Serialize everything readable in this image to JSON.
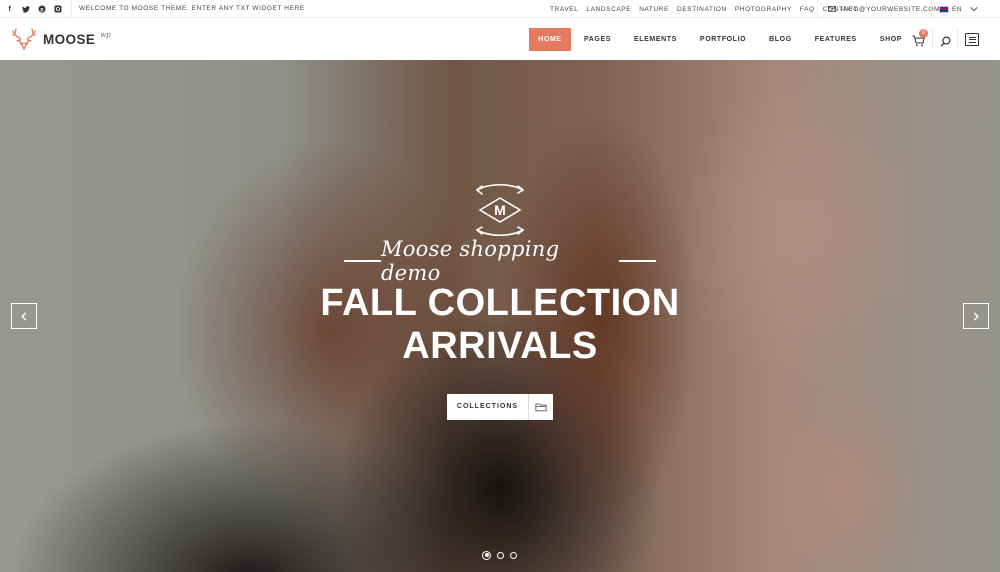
{
  "topbar": {
    "social": [
      {
        "icon": "facebook-icon",
        "glyph": "f"
      },
      {
        "icon": "twitter-icon",
        "glyph": "t"
      },
      {
        "icon": "pinterest-icon",
        "glyph": "p"
      },
      {
        "icon": "instagram-icon",
        "glyph": "◘"
      }
    ],
    "welcome": "WELCOME TO MOOSE THEME. ENTER ANY TXT WIDGET HERE",
    "links": [
      "TRAVEL",
      "LANDSCAPE",
      "NATURE",
      "DESTINATION",
      "PHOTOGRAPHY",
      "FAQ",
      "CONTACT"
    ],
    "email": "INFO@YOURWEBSITE.COM",
    "language": "EN"
  },
  "nav": {
    "logo_name": "MOOSE",
    "logo_tag": "wp",
    "menu": [
      "HOME",
      "PAGES",
      "ELEMENTS",
      "PORTFOLIO",
      "BLOG",
      "FEATURES",
      "SHOP"
    ],
    "active": "HOME",
    "cart_count": "0"
  },
  "hero": {
    "emblem_letter": "M",
    "subtitle": "Moose shopping demo",
    "headline_line1": "FALL COLLECTION",
    "headline_line2": "ARRIVALS",
    "cta_label": "COLLECTIONS",
    "slides": 3,
    "active_slide": 1
  },
  "colors": {
    "accent": "#e57b5e",
    "text": "#333333"
  }
}
